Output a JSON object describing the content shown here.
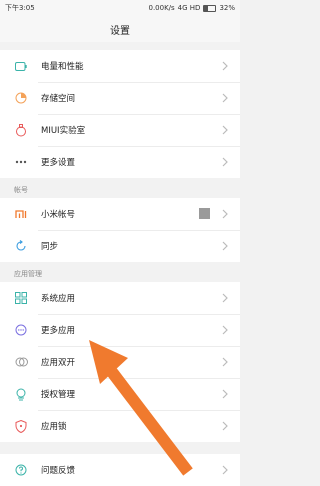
{
  "status_bar": {
    "time": "下午3:05",
    "network_speed": "0.00K/s",
    "network": "4G HD",
    "battery": "32%"
  },
  "title": "设置",
  "groups": [
    {
      "header": "",
      "items": [
        {
          "label": "电量和性能",
          "icon": "battery-icon"
        },
        {
          "label": "存储空间",
          "icon": "storage-icon"
        },
        {
          "label": "MIUI实验室",
          "icon": "lab-flask-icon"
        },
        {
          "label": "更多设置",
          "icon": "more-dots-icon"
        }
      ]
    },
    {
      "header": "帐号",
      "items": [
        {
          "label": "小米帐号",
          "icon": "mi-logo-icon"
        },
        {
          "label": "同步",
          "icon": "sync-icon"
        }
      ]
    },
    {
      "header": "应用管理",
      "items": [
        {
          "label": "系统应用",
          "icon": "grid-icon"
        },
        {
          "label": "更多应用",
          "icon": "more-apps-icon"
        },
        {
          "label": "应用双开",
          "icon": "dual-apps-icon"
        },
        {
          "label": "授权管理",
          "icon": "permission-icon"
        },
        {
          "label": "应用锁",
          "icon": "app-lock-icon"
        }
      ]
    },
    {
      "header": "",
      "items": [
        {
          "label": "问题反馈",
          "icon": "feedback-icon"
        }
      ]
    }
  ],
  "colors": {
    "arrow": "#f07a2e",
    "icon_accent": "#3bb3a9",
    "orange_accent": "#f4a259"
  }
}
